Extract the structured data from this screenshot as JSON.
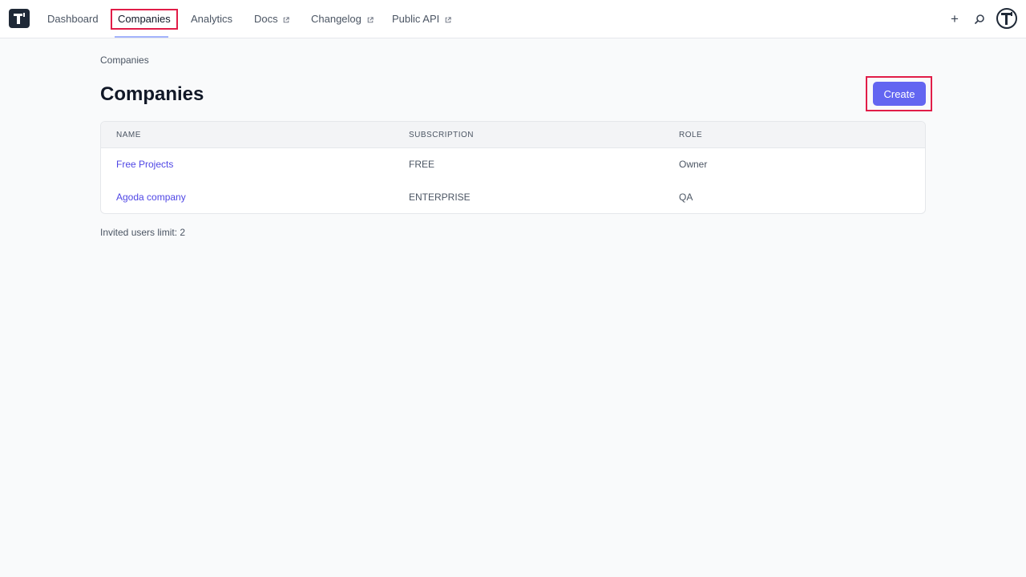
{
  "nav": {
    "items": [
      {
        "label": "Dashboard"
      },
      {
        "label": "Companies"
      },
      {
        "label": "Analytics"
      },
      {
        "label": "Docs"
      },
      {
        "label": "Changelog"
      },
      {
        "label": "Public API"
      }
    ],
    "plus_label": "+"
  },
  "breadcrumb": "Companies",
  "page_title": "Companies",
  "create_label": "Create",
  "table": {
    "headers": [
      "NAME",
      "SUBSCRIPTION",
      "ROLE"
    ],
    "rows": [
      {
        "name": "Free Projects",
        "subscription": "FREE",
        "role": "Owner"
      },
      {
        "name": "Agoda company",
        "subscription": "ENTERPRISE",
        "role": "QA"
      }
    ]
  },
  "invited_limit": "Invited users limit: 2",
  "colors": {
    "accent": "#6366f1",
    "link": "#4f46e5",
    "highlight": "#e11d48"
  },
  "icons": [
    "app-logo-icon",
    "external-link-icon",
    "plus-icon",
    "lens-icon",
    "avatar-icon"
  ]
}
